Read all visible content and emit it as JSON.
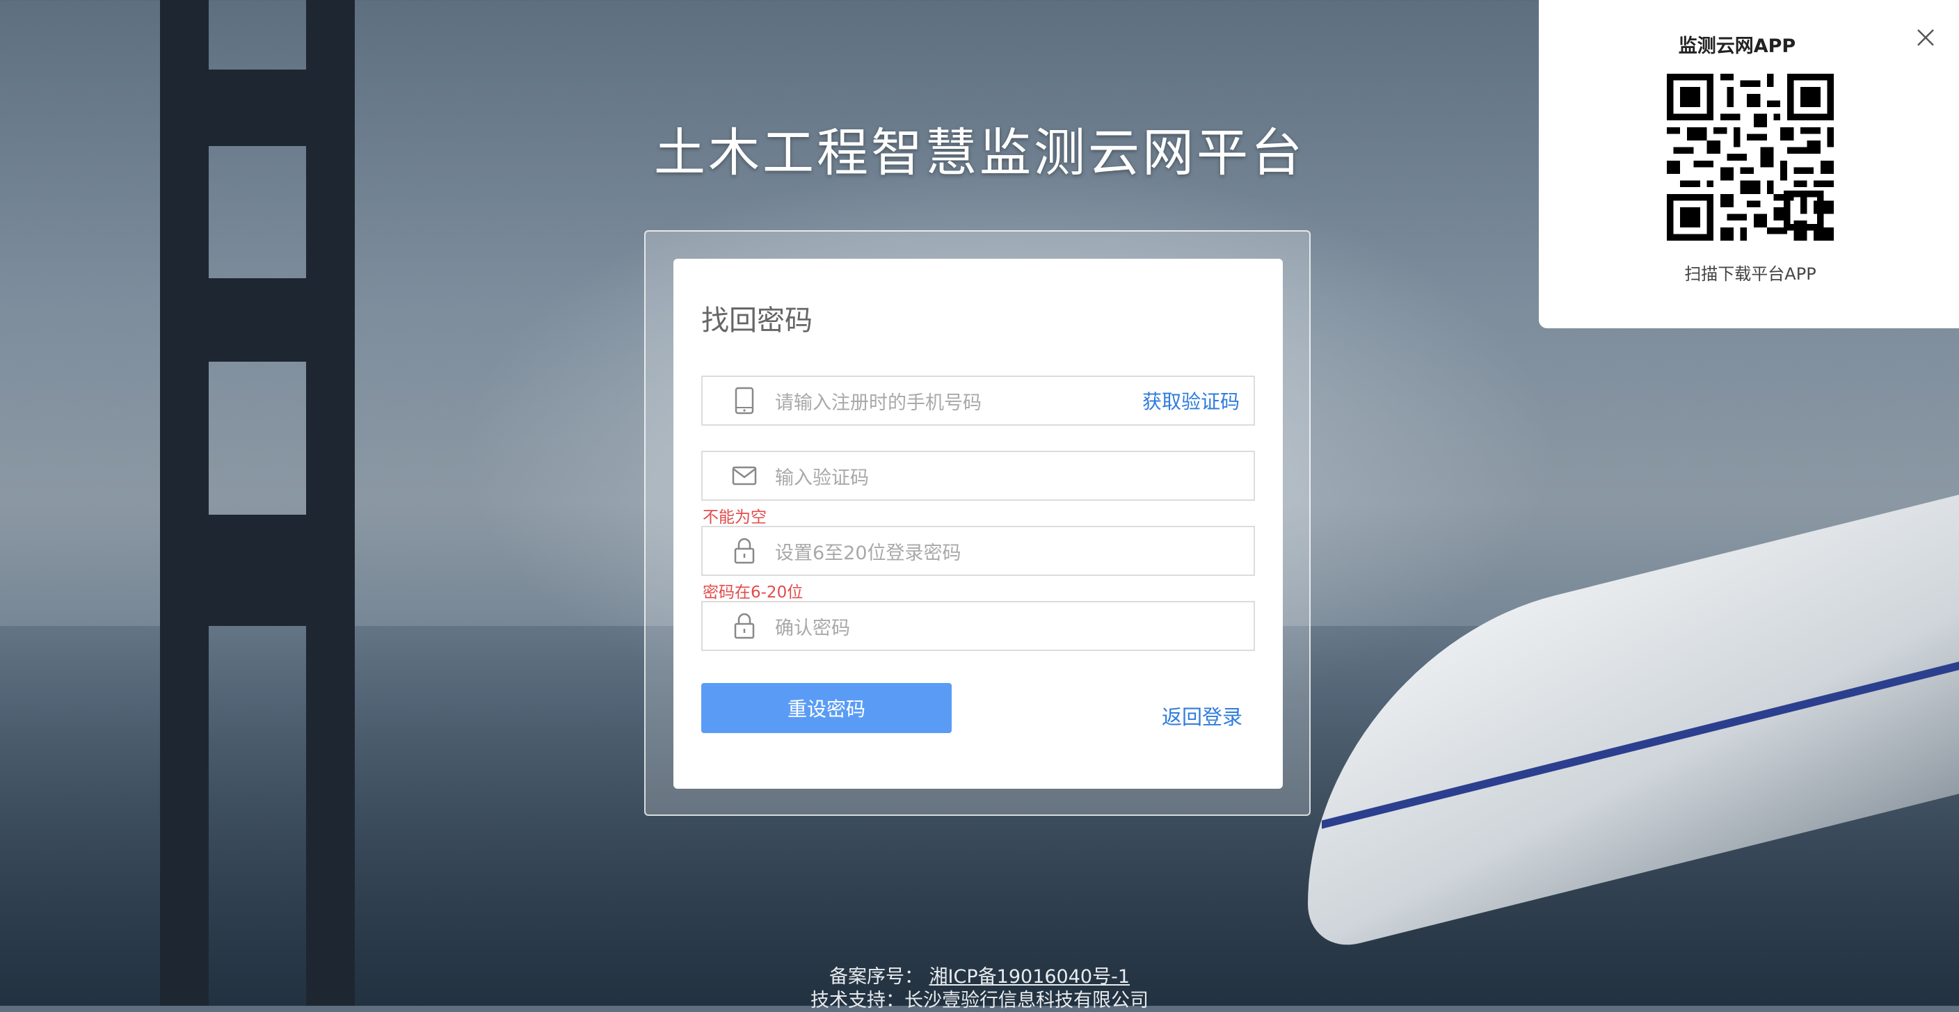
{
  "site_title": "土木工程智慧监测云网平台",
  "form": {
    "title": "找回密码",
    "phone_placeholder": "请输入注册时的手机号码",
    "get_code_label": "获取验证码",
    "code_placeholder": "输入验证码",
    "code_error": "不能为空",
    "password_placeholder": "设置6至20位登录密码",
    "password_error": "密码在6-20位",
    "confirm_placeholder": "确认密码",
    "reset_button": "重设密码",
    "back_link": "返回登录"
  },
  "qr_panel": {
    "title": "监测云网APP",
    "caption": "扫描下载平台APP"
  },
  "footer": {
    "record_label": "备案序号：",
    "record_value": "湘ICP备19016040号-1",
    "support_label": "技术支持：长沙壹验行信息科技有限公司"
  },
  "colors": {
    "accent": "#2f7cdc",
    "button": "#5a9cf5",
    "error": "#e34b4b"
  }
}
